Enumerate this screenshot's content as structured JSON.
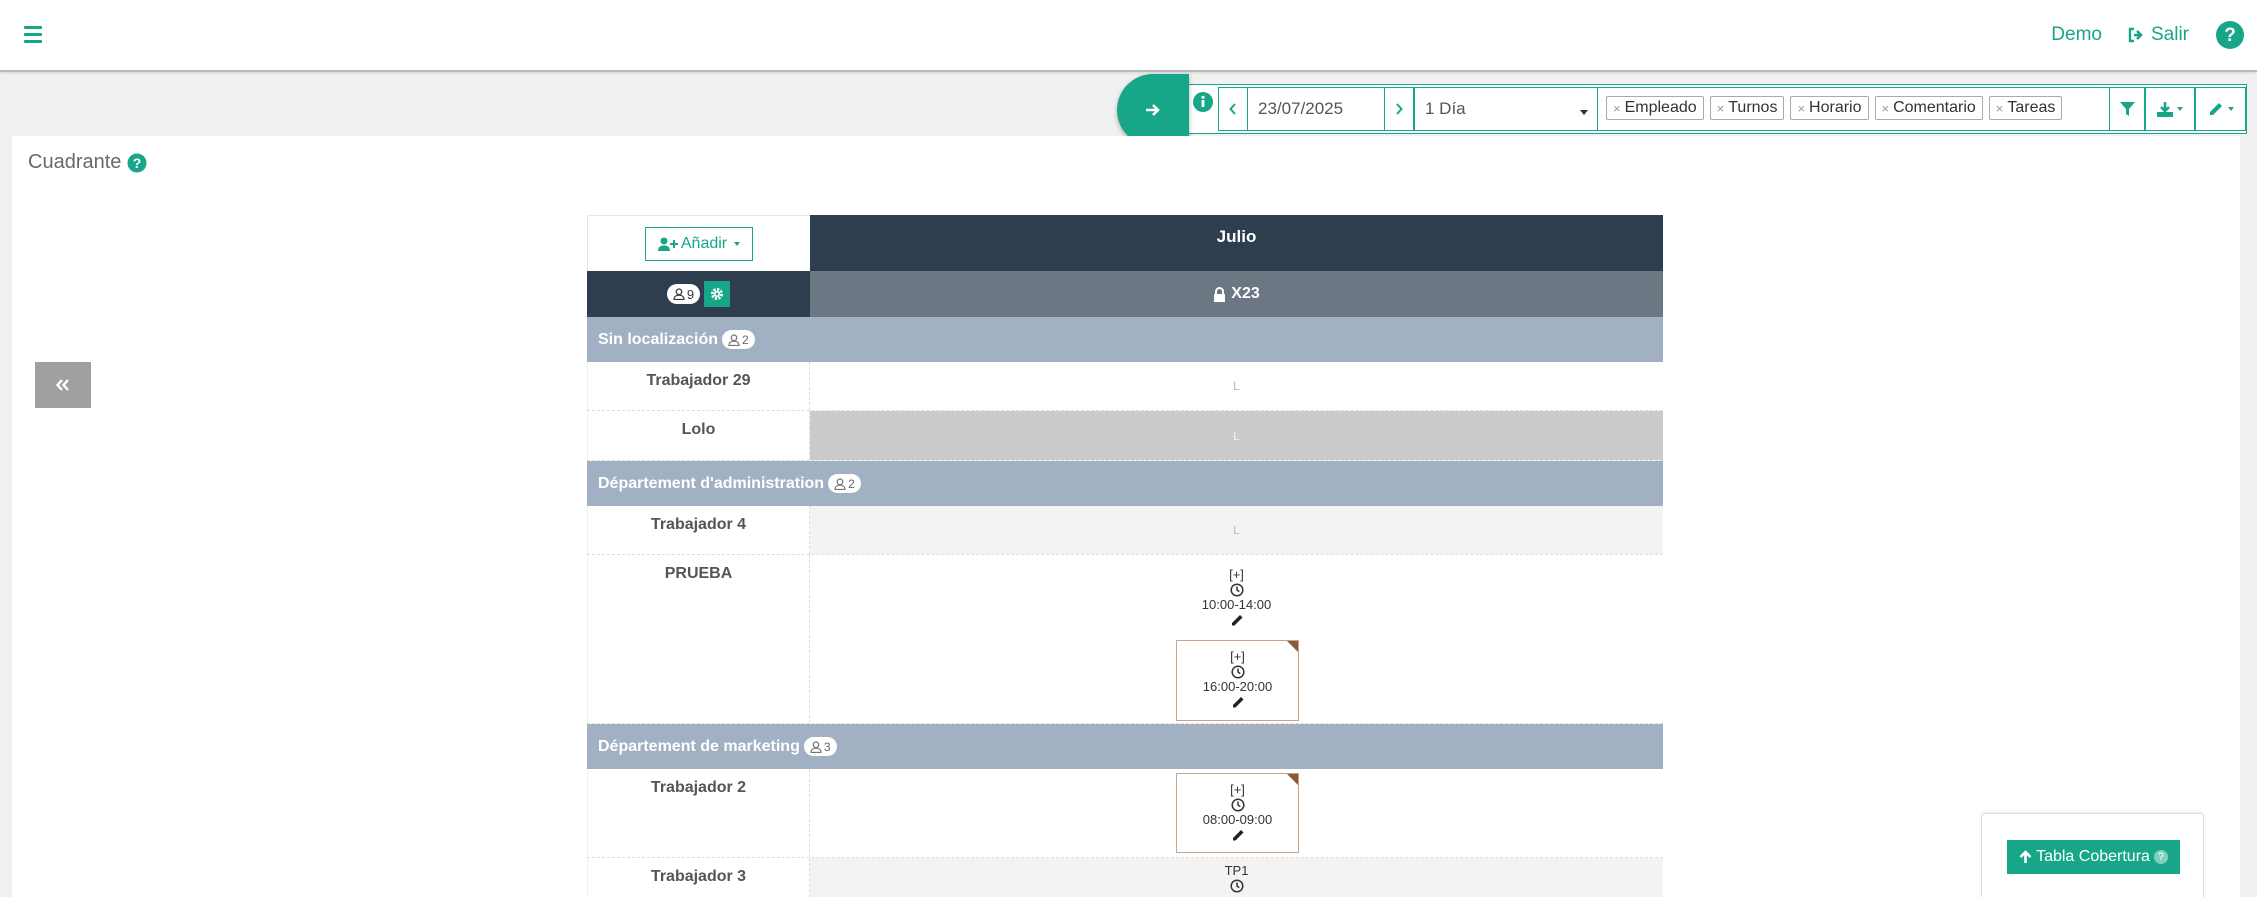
{
  "nav": {
    "user_label": "Demo",
    "logout_label": "Salir"
  },
  "toolbar": {
    "date_value": "23/07/2025",
    "period_value": "1 Día",
    "chips": [
      "Empleado",
      "Turnos",
      "Horario",
      "Comentario",
      "Tareas"
    ]
  },
  "panel": {
    "title": "Cuadrante"
  },
  "grid": {
    "add_label": "Añadir",
    "month_label": "Julio",
    "total_count": "9",
    "day_label": "X23",
    "groups": [
      {
        "name": "Sin localización",
        "count": "2",
        "employees": [
          {
            "name": "Trabajador 29",
            "cell": "L"
          },
          {
            "name": "Lolo",
            "cell": "L"
          }
        ]
      },
      {
        "name": "Département d'administration",
        "count": "2",
        "employees": [
          {
            "name": "Trabajador 4",
            "cell": "L"
          },
          {
            "name": "PRUEBA",
            "shifts": [
              {
                "plus": "[+]",
                "time": "10:00-14:00"
              },
              {
                "plus": "[+]",
                "time": "16:00-20:00"
              }
            ]
          }
        ]
      },
      {
        "name": "Département de marketing",
        "count": "3",
        "employees": [
          {
            "name": "Trabajador 2",
            "shifts": [
              {
                "plus": "[+]",
                "time": "08:00-09:00"
              }
            ]
          },
          {
            "name": "Trabajador 3",
            "shifts": [
              {
                "code": "TP1"
              }
            ]
          }
        ]
      }
    ]
  },
  "coverage": {
    "button_label": "Tabla Cobertura"
  },
  "colors": {
    "accent": "#18a689",
    "header_dark": "#2e3e4f",
    "header_gray": "#6b7883",
    "group_bg": "#a1b1c3"
  }
}
